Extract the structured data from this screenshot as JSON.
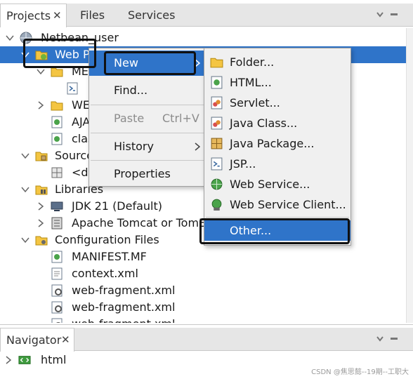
{
  "projects": {
    "tabs": [
      {
        "label": "Projects",
        "closable": true,
        "active": true
      },
      {
        "label": "Files",
        "closable": false,
        "active": false
      },
      {
        "label": "Services",
        "closable": false,
        "active": false
      }
    ],
    "tree": [
      {
        "label": "Netbean_user",
        "icon": "globe-icon"
      },
      {
        "label": "Web P",
        "icon": "web-pages-folder-icon"
      },
      {
        "label": "ME",
        "icon": "folder-icon"
      },
      {
        "label": "",
        "icon": "jsp-file-icon"
      },
      {
        "label": "WE",
        "icon": "folder-icon"
      },
      {
        "label": "AJA",
        "icon": "html-file-icon"
      },
      {
        "label": "clas",
        "icon": "html-file-icon"
      },
      {
        "label": "Source",
        "icon": "source-folder-icon"
      },
      {
        "label": "<de",
        "icon": "package-icon"
      },
      {
        "label": "Libraries",
        "icon": "library-folder-icon"
      },
      {
        "label": "JDK 21 (Default)",
        "icon": "jdk-icon"
      },
      {
        "label": "Apache Tomcat or TomEE",
        "icon": "server-library-icon"
      },
      {
        "label": "Configuration Files",
        "icon": "config-folder-icon"
      },
      {
        "label": "MANIFEST.MF",
        "icon": "manifest-file-icon"
      },
      {
        "label": "context.xml",
        "icon": "xml-file-icon"
      },
      {
        "label": "web-fragment.xml",
        "icon": "xml-config-icon"
      },
      {
        "label": "web-fragment.xml",
        "icon": "xml-config-icon"
      },
      {
        "label": "web-fragment.xml",
        "icon": "xml-config-icon"
      }
    ]
  },
  "context_menu": {
    "new": "New",
    "find": "Find...",
    "paste": "Paste",
    "paste_shortcut": "Ctrl+V",
    "history": "History",
    "properties": "Properties"
  },
  "submenu": {
    "items": [
      {
        "label": "Folder...",
        "icon": "folder-icon"
      },
      {
        "label": "HTML...",
        "icon": "html-file-icon"
      },
      {
        "label": "Servlet...",
        "icon": "servlet-icon"
      },
      {
        "label": "Java Class...",
        "icon": "java-class-icon"
      },
      {
        "label": "Java Package...",
        "icon": "java-package-icon"
      },
      {
        "label": "JSP...",
        "icon": "jsp-file-icon"
      },
      {
        "label": "Web Service...",
        "icon": "web-service-icon"
      },
      {
        "label": "Web Service Client...",
        "icon": "web-service-client-icon"
      },
      {
        "label": "Other...",
        "icon": ""
      }
    ]
  },
  "navigator": {
    "tab_label": "Navigator",
    "tree_root": "html"
  },
  "watermark": "CSDN @焦思懿--19期--工职大",
  "colors": {
    "selection": "#2f74c9",
    "menu_bg": "#f0f0f0",
    "tab_bg": "#e6e6e6"
  }
}
